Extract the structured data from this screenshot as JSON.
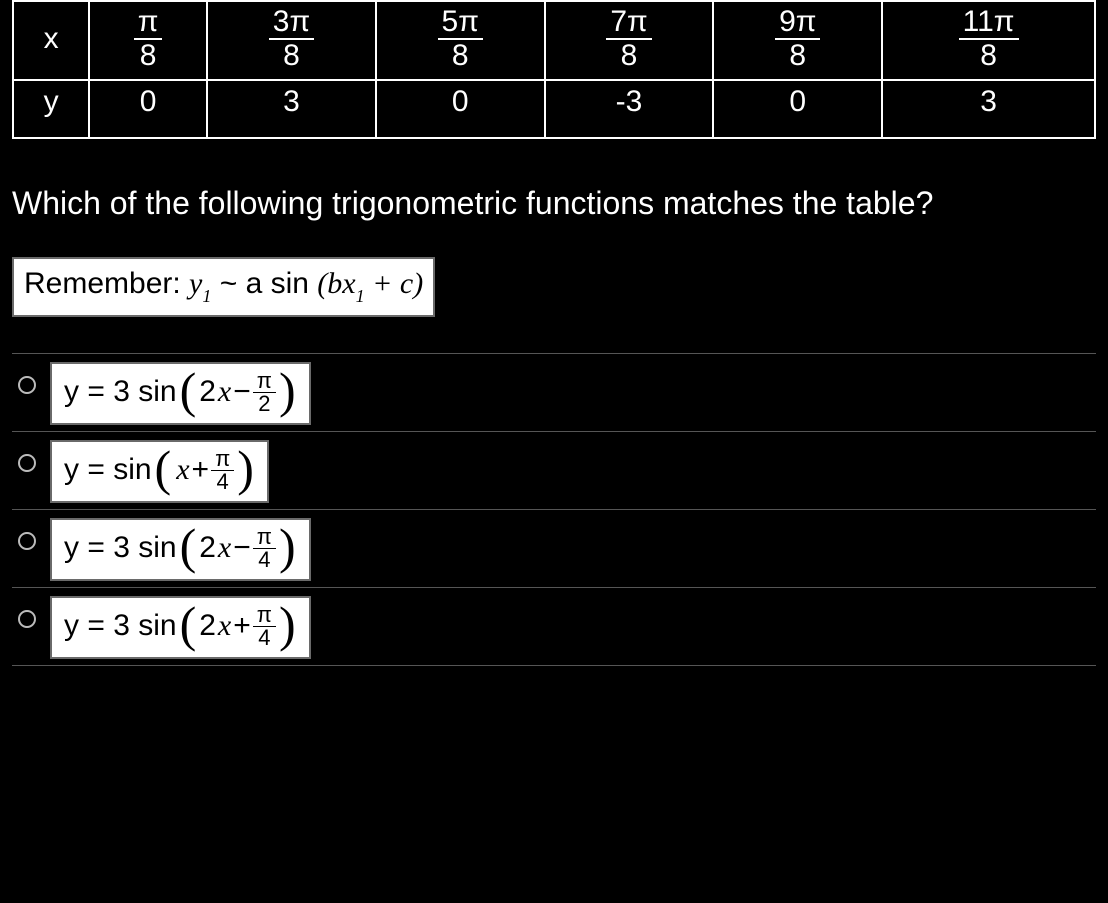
{
  "table": {
    "row_label_x": "x",
    "row_label_y": "y",
    "x": [
      {
        "num": "π",
        "den": "8"
      },
      {
        "num": "3π",
        "den": "8"
      },
      {
        "num": "5π",
        "den": "8"
      },
      {
        "num": "7π",
        "den": "8"
      },
      {
        "num": "9π",
        "den": "8"
      },
      {
        "num": "11π",
        "den": "8"
      }
    ],
    "y": [
      "0",
      "3",
      "0",
      "-3",
      "0",
      "3"
    ]
  },
  "question": "Which of the following trigonometric functions matches the table?",
  "hint": {
    "prefix": "Remember:  ",
    "y": "y",
    "sub": "1",
    "tilde": " ~ a sin ",
    "lpar": "(",
    "bx": "bx",
    "sub2": "1",
    "plus": " + ",
    "c": "c",
    "rpar": ")"
  },
  "options": [
    {
      "lhs": "y = 3 sin ",
      "inner_left": "2",
      "var": "x",
      "op": " − ",
      "frac_num": "π",
      "frac_den": "2"
    },
    {
      "lhs": "y = sin ",
      "inner_left": "",
      "var": "x",
      "op": " + ",
      "frac_num": "π",
      "frac_den": "4"
    },
    {
      "lhs": "y = 3 sin ",
      "inner_left": "2",
      "var": "x",
      "op": " − ",
      "frac_num": "π",
      "frac_den": "4"
    },
    {
      "lhs": "y = 3 sin ",
      "inner_left": "2",
      "var": "x",
      "op": " + ",
      "frac_num": "π",
      "frac_den": "4"
    }
  ]
}
